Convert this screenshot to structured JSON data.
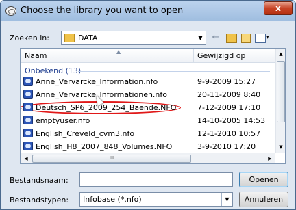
{
  "window": {
    "title": "Choose the library you want to open",
    "close_label": "x"
  },
  "toolbar": {
    "lookin_label": "Zoeken in:",
    "lookin_value": "DATA",
    "back_glyph": "←"
  },
  "list": {
    "columns": {
      "name": "Naam",
      "date": "Gewijzigd op"
    },
    "group_label": "Onbekend (13)",
    "files": [
      {
        "name": "Anne_Vervarcke_Information.nfo",
        "date": "9-9-2009 15:27"
      },
      {
        "name": "Anne_Vervarcke_Informationen.nfo",
        "date": "20-11-2009 8:40"
      },
      {
        "name": "Deutsch_SP6_2009_254_Baende.NFO",
        "date": "7-12-2009 17:10",
        "highlighted": true
      },
      {
        "name": "emptyuser.nfo",
        "date": "14-10-2005 14:53"
      },
      {
        "name": "English_Creveld_cvm3.nfo",
        "date": "12-1-2010 10:57"
      },
      {
        "name": "English_H8_2007_848_Volumes.NFO",
        "date": "3-9-2010 17:20"
      }
    ],
    "hscroll_grip": "III"
  },
  "footer": {
    "filename_label": "Bestandsnaam:",
    "filename_value": "",
    "filetype_label": "Bestandstypen:",
    "filetype_value": "Infobase (*.nfo)",
    "open_label": "Openen",
    "cancel_label": "Annuleren"
  },
  "colors": {
    "highlight_ring": "#e01818",
    "group_text": "#1e3d8f"
  }
}
